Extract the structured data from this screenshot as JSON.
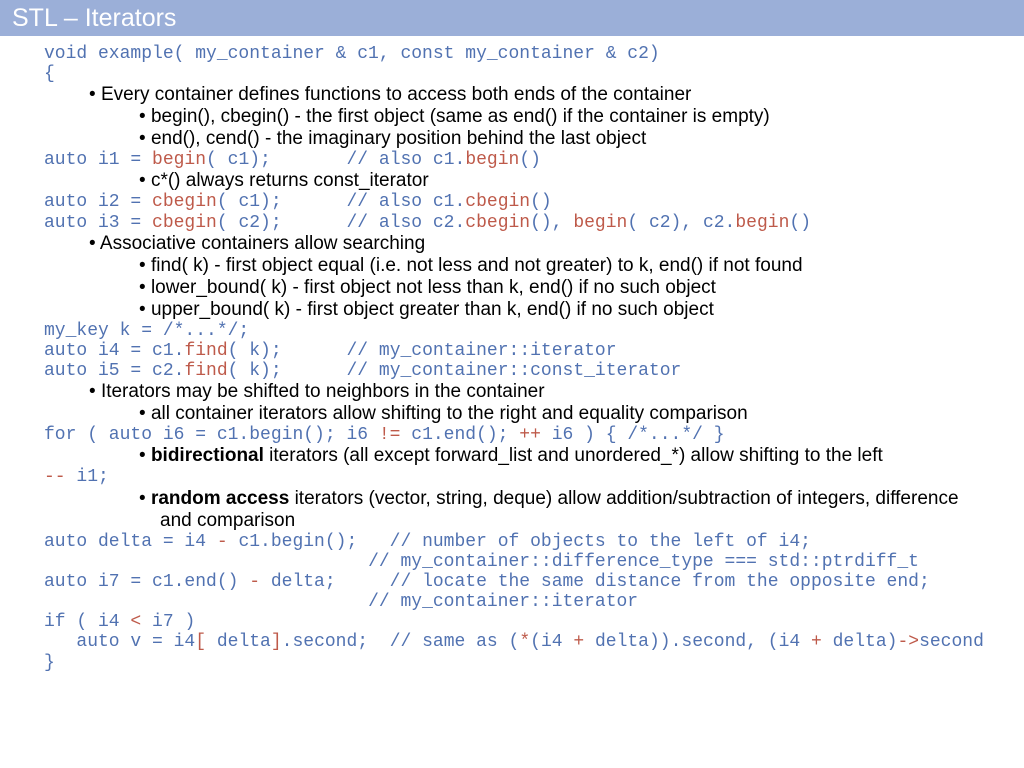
{
  "title": "STL – Iterators",
  "sig1": "void example( my_container & c1, const my_container & c2)",
  "sig2": "{",
  "bul_container_ends": "Every container defines functions to access both ends of the container",
  "bul_begin": "begin(), cbegin() - the first object (same as end() if the container is empty)",
  "bul_end": "end(), cend() - the imaginary position behind the last object",
  "code_i1_a": "auto i1 = ",
  "code_i1_b": "begin",
  "code_i1_c": "( c1);       ",
  "code_i1_d": "// also c1.",
  "code_i1_e": "begin",
  "code_i1_f": "()",
  "bul_cstar": "c*() always returns const_iterator",
  "code_i2_a": "auto i2 = ",
  "code_i2_b": "cbegin",
  "code_i2_c": "( c1);      ",
  "code_i2_d": "// also c1.",
  "code_i2_e": "cbegin",
  "code_i2_f": "()",
  "code_i3_a": "auto i3 = ",
  "code_i3_b": "cbegin",
  "code_i3_c": "( c2);      ",
  "code_i3_d": "// also c2.",
  "code_i3_e": "cbegin",
  "code_i3_f": "(), ",
  "code_i3_g": "begin",
  "code_i3_h": "( c2), c2.",
  "code_i3_i": "begin",
  "code_i3_j": "()",
  "bul_assoc": "Associative containers allow searching",
  "bul_find": "find( k) - first object equal (i.e. not less and not greater) to k, end() if not found",
  "bul_lower": "lower_bound( k) - first object not less than k, end() if no such object",
  "bul_upper": "upper_bound( k) - first object greater than k, end() if no such object",
  "code_k": "my_key k = /*...*/;",
  "code_i4_a": "auto i4 = c1.",
  "code_i4_b": "find",
  "code_i4_c": "( k);      ",
  "code_i4_d": "// my_container::iterator",
  "code_i5_a": "auto i5 = c2.",
  "code_i5_b": "find",
  "code_i5_c": "( k);      ",
  "code_i5_d": "// my_container::const_iterator",
  "bul_shift": "Iterators may be shifted to neighbors in the container",
  "bul_allshift": "all container iterators allow shifting to the right and equality comparison",
  "code_for_a": "for ( auto i6 = c1.begin(); i6 ",
  "code_for_b": "!=",
  "code_for_c": " c1.end(); ",
  "code_for_d": "++",
  "code_for_e": " i6 ) { /*...*/ }",
  "bul_bidir_b": "bidirectional",
  "bul_bidir_t": " iterators (all except forward_list and unordered_*) allow shifting to the left",
  "code_dec_a": "--",
  "code_dec_b": " i1;",
  "bul_rand_b": "random access",
  "bul_rand_t": " iterators (vector, string, deque) allow addition/subtraction of integers, difference",
  "bul_rand_t2": "and comparison",
  "code_delta_a": "auto delta = i4 ",
  "code_delta_b": "-",
  "code_delta_c": " c1.begin();   ",
  "code_delta_d": "// number of objects to the left of i4;",
  "code_delta_e": "// my_container::difference_type === std::ptrdiff_t",
  "code_i7_a": "auto i7 = c1.end() ",
  "code_i7_b": "-",
  "code_i7_c": " delta;     ",
  "code_i7_d": "// locate the same distance from the opposite end;",
  "code_i7_e": "// my_container::iterator",
  "code_if_a": "if ( i4 ",
  "code_if_b": "<",
  "code_if_c": " i7 )",
  "code_v_a": "   auto v = i4",
  "code_v_b": "[",
  "code_v_c": " delta",
  "code_v_d": "]",
  "code_v_e": ".second;  ",
  "code_v_f": "// same as (",
  "code_v_g": "*",
  "code_v_h": "(i4 ",
  "code_v_i": "+",
  "code_v_j": " delta)).second, (i4 ",
  "code_v_k": "+",
  "code_v_l": " delta)",
  "code_v_m": "->",
  "code_v_n": "second",
  "close": "}",
  "pad30": "                              "
}
